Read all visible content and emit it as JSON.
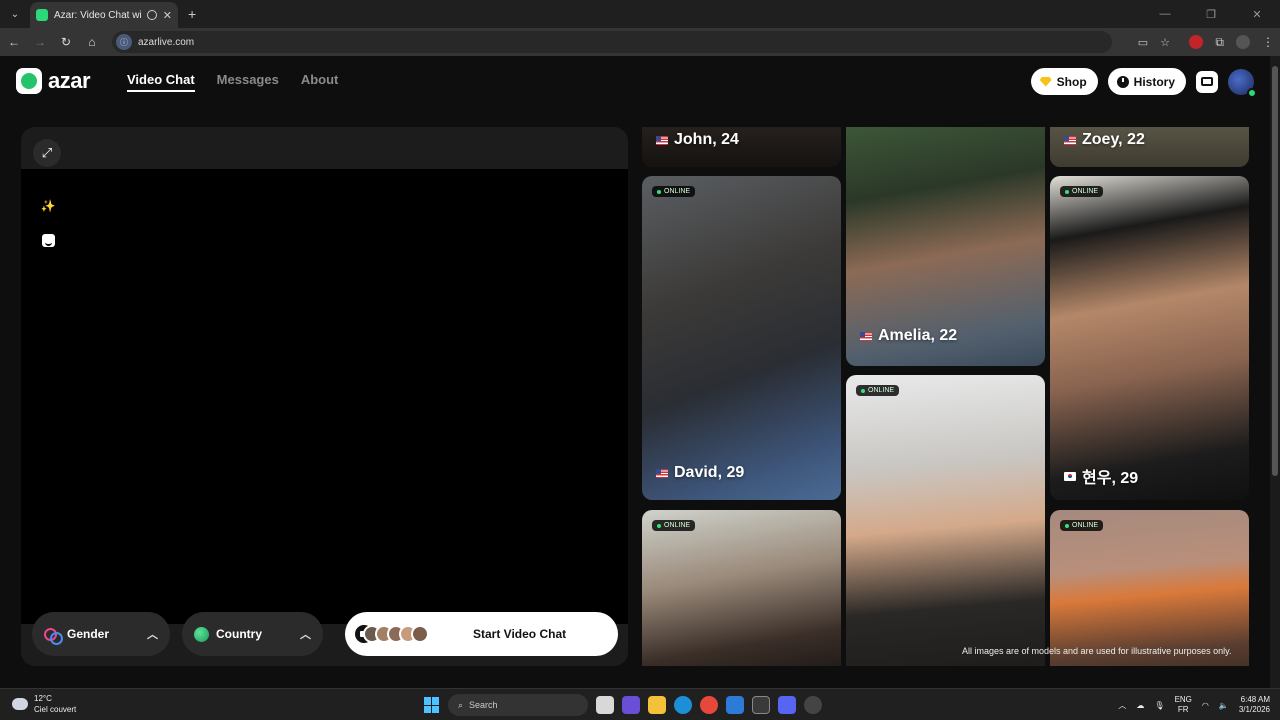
{
  "browser": {
    "tab_title": "Azar: Video Chat with New",
    "url": "azarlive.com",
    "new_tab": "+",
    "minimize": "—",
    "restore": "❐",
    "close": "✕"
  },
  "header": {
    "logo_text": "azar",
    "nav": [
      "Video Chat",
      "Messages",
      "About"
    ],
    "shop_label": "Shop",
    "history_label": "History"
  },
  "video": {
    "gender_label": "Gender",
    "country_label": "Country",
    "start_label": "Start Video Chat"
  },
  "gallery": {
    "online_label": "ONLINE",
    "cards": [
      {
        "name": "John, 24",
        "flag": "us"
      },
      {
        "name": "Zoey, 22",
        "flag": "us"
      },
      {
        "name": "Amelia, 22",
        "flag": "us"
      },
      {
        "name": "David, 29",
        "flag": "us"
      },
      {
        "name": "현우, 29",
        "flag": "kr"
      }
    ],
    "disclaimer": "All images are of models and are used for illustrative purposes only."
  },
  "taskbar": {
    "temp": "12°C",
    "weather": "Ciel couvert",
    "search_label": "Search",
    "lang": "ENG",
    "region": "FR",
    "time": "6:48 AM",
    "date": "3/1/2026"
  },
  "colors": {
    "brand_green": "#2bd97a",
    "page_bg": "#0e0e0e",
    "panel_bg": "#1c1c1c"
  }
}
